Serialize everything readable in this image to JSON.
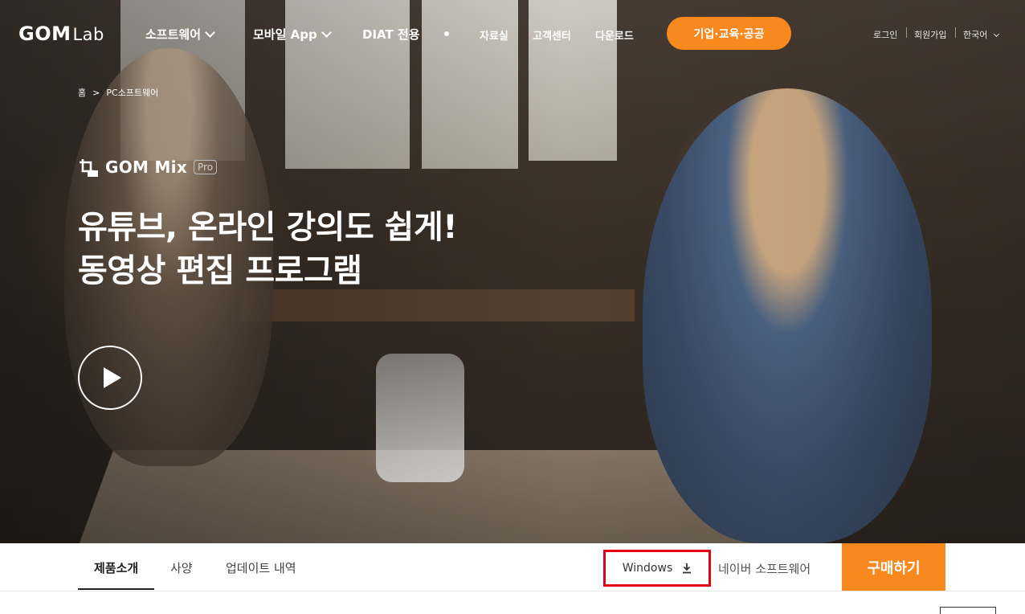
{
  "nav": {
    "logo_main": "GOM",
    "logo_sub": "Lab",
    "items": [
      {
        "label": "소프트웨어"
      },
      {
        "label": "모바일 App"
      },
      {
        "label": "DIAT 전용"
      },
      {
        "label": "자료실"
      },
      {
        "label": "고객센터"
      },
      {
        "label": "다운로드"
      }
    ],
    "cta_label": "기업·교육·공공",
    "util": {
      "login": "로그인",
      "signup": "회원가입",
      "language": "한국어"
    }
  },
  "breadcrumb": {
    "home": "홈",
    "separator": ">",
    "current": "PC소프트웨어"
  },
  "product": {
    "name": "GOM Mix",
    "badge": "Pro",
    "icon_badge": "Pro",
    "headline_line1": "유튜브, 온라인 강의도 쉽게!",
    "headline_line2": "동영상 편집 프로그램"
  },
  "tabs": {
    "items": [
      {
        "label": "제품소개"
      },
      {
        "label": "사양"
      },
      {
        "label": "업데이트 내역"
      }
    ],
    "windows_download": "Windows",
    "naver_link": "네이버 소프트웨어",
    "buy_label": "구매하기"
  },
  "colors": {
    "accent": "#f7891f",
    "highlight": "#e60012"
  }
}
